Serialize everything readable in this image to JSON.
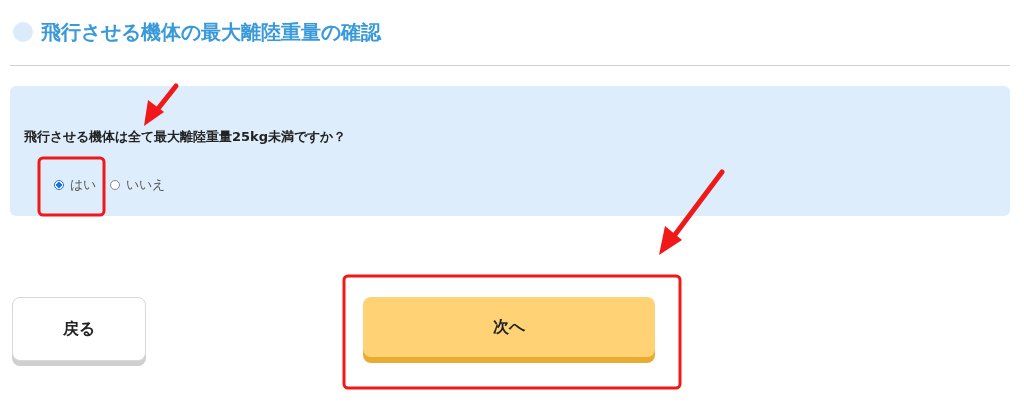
{
  "heading": "飛行させる機体の最大離陸重量の確認",
  "question": {
    "text": "飛行させる機体は全て最大離陸重量25kg未満ですか？",
    "options": [
      {
        "label": "はい",
        "selected": true
      },
      {
        "label": "いいえ",
        "selected": false
      }
    ]
  },
  "buttons": [
    {
      "kind": "back",
      "label": "戻る"
    },
    {
      "kind": "next",
      "label": "次へ"
    }
  ]
}
